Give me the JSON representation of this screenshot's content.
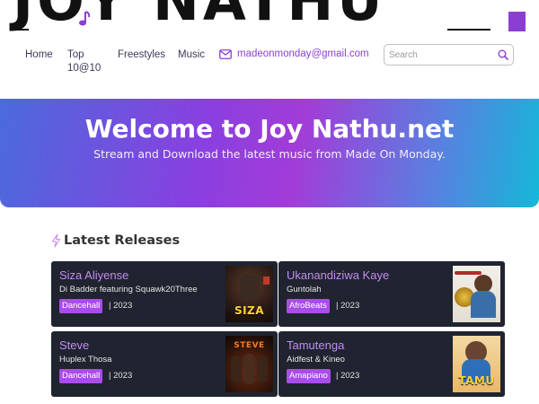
{
  "site": {
    "logo_text": "JOY NATHU",
    "brand_color": "#8b3fd1"
  },
  "nav": {
    "items": [
      {
        "label": "Home"
      },
      {
        "label": "Top\n10@10"
      },
      {
        "label": "Freestyles"
      },
      {
        "label": "Music"
      }
    ],
    "email": "madeonmonday@gmail.com",
    "email_icon": "mail-icon"
  },
  "search": {
    "placeholder": "Search",
    "icon": "search-icon"
  },
  "hero": {
    "title": "Welcome to Joy Nathu.net",
    "subtitle": "Stream and Download the latest music from Made On Monday."
  },
  "latest": {
    "title": "Latest Releases",
    "icon": "lightning-icon",
    "releases": [
      {
        "title": "Siza Aliyense",
        "artist": "Di Badder featuring Squawk20Three",
        "genre": "Dancehall",
        "year": "| 2023",
        "art_text": "SIZA"
      },
      {
        "title": "Ukanandiziwa Kaye",
        "artist": "Guntolah",
        "genre": "AfroBeats",
        "year": "| 2023",
        "art_text": ""
      },
      {
        "title": "Steve",
        "artist": "Huplex Thosa",
        "genre": "Dancehall",
        "year": "| 2023",
        "art_text": "STEVE"
      },
      {
        "title": "Tamutenga",
        "artist": "Aidfest & Kineo",
        "genre": "Amapiano",
        "year": "| 2023",
        "art_text": "TAMU"
      }
    ]
  }
}
